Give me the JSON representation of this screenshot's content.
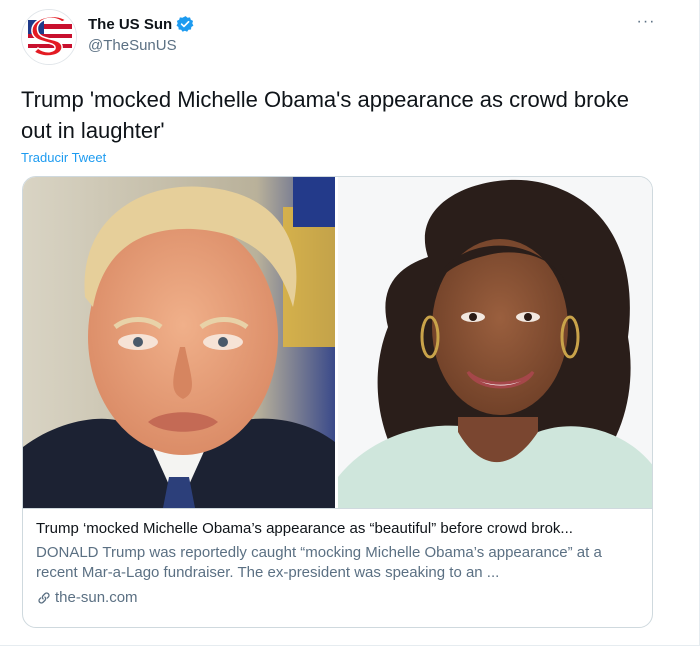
{
  "account": {
    "display_name": "The US Sun",
    "handle": "@TheSunUS",
    "verified_icon": "verified-badge-icon",
    "avatar_icon": "the-sun-logo"
  },
  "header": {
    "more_label": "···"
  },
  "tweet": {
    "text": "Trump 'mocked Michelle Obama's appearance as crowd broke out in laughter'",
    "translate_label": "Traducir Tweet"
  },
  "card": {
    "title": "Trump ‘mocked Michelle Obama’s appearance as “beautiful” before crowd brok...",
    "description": "DONALD Trump was reportedly caught “mocking Michelle Obama’s appearance” at a recent Mar-a-Lago fundraiser. The ex-president was speaking to an ...",
    "domain": "the-sun.com",
    "link_icon": "link-icon",
    "images": [
      "donald-trump-photo",
      "michelle-obama-photo"
    ]
  },
  "colors": {
    "accent": "#1d9bf0",
    "secondary_text": "#5b7083",
    "border": "#cfd9de"
  }
}
